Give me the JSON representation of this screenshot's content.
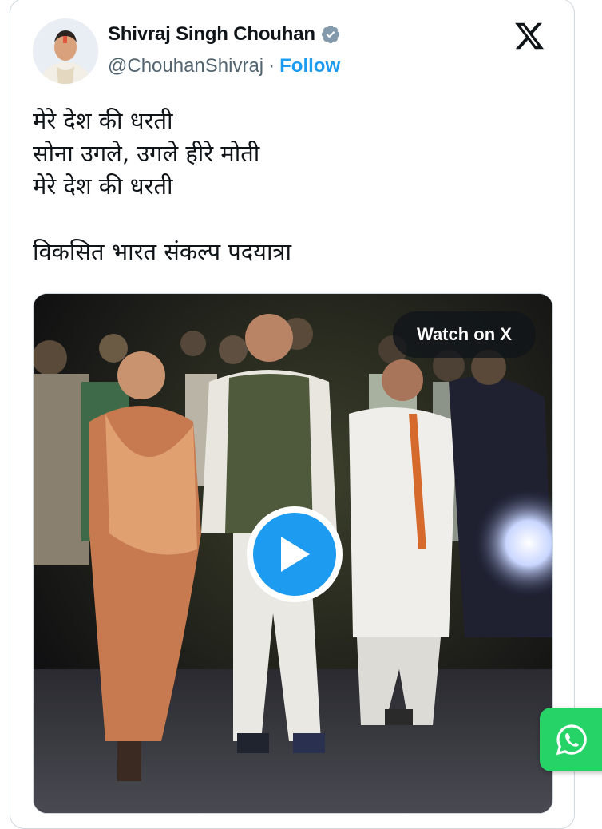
{
  "author": {
    "display_name": "Shivraj Singh Chouhan",
    "handle": "@ChouhanShivraj",
    "separator": "·",
    "follow_label": "Follow"
  },
  "tweet": {
    "lines": [
      "मेरे देश की धरती",
      "सोना उगले, उगले हीरे मोती",
      "मेरे देश की धरती",
      "",
      "विकसित भारत संकल्प पदयात्रा"
    ]
  },
  "media": {
    "watch_label": "Watch on X"
  },
  "colors": {
    "accent": "#1d9bf0",
    "verified": "#829aab",
    "whatsapp": "#25d366"
  },
  "icons": [
    "verified-badge-icon",
    "x-logo-icon",
    "play-icon",
    "whatsapp-icon"
  ]
}
